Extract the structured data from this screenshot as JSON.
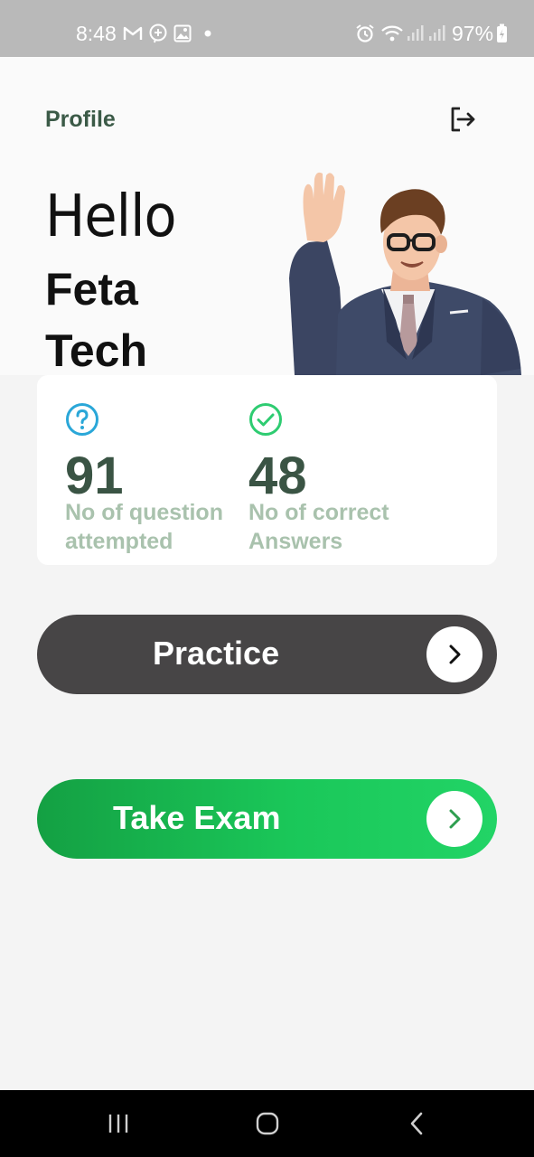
{
  "status_bar": {
    "time": "8:48",
    "battery": "97%",
    "icons": [
      "gmail-icon",
      "messenger-icon",
      "gallery-icon",
      "dot-icon",
      "alarm-icon",
      "wifi-icon",
      "signal-icon",
      "signal-icon",
      "battery-charging-icon"
    ]
  },
  "header": {
    "title": "Profile",
    "greeting": "Hello",
    "first_name": "Feta",
    "last_name": "Tech"
  },
  "stats": [
    {
      "value": "91",
      "label": "No of question attempted",
      "icon": "question-circle-icon",
      "color": "#2aa7d8"
    },
    {
      "value": "48",
      "label": "No of correct Answers",
      "icon": "check-circle-icon",
      "color": "#2ecc71"
    }
  ],
  "buttons": {
    "practice": "Practice",
    "exam": "Take Exam"
  },
  "colors": {
    "accent_green": "#1ac759",
    "dark_button": "#474546",
    "stat_value": "#3a5444",
    "stat_label": "#a9c2ad"
  }
}
